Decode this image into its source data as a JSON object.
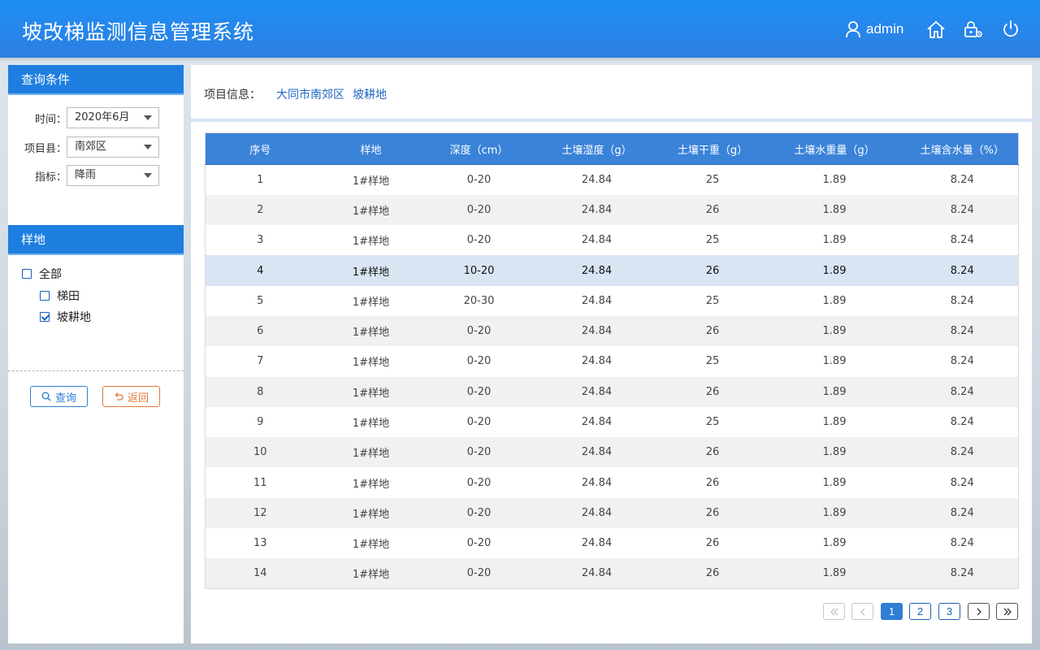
{
  "header": {
    "app_title": "坡改梯监测信息管理系统",
    "user": "admin",
    "icons": [
      "user-icon",
      "home-icon",
      "lock-settings-icon",
      "power-icon"
    ]
  },
  "query": {
    "title": "查询条件",
    "time_label": "时间：",
    "time_value": "2020年6月",
    "county_label": "项目县：",
    "county_value": "南郊区",
    "index_label": "指标：",
    "index_value": "降雨"
  },
  "plots": {
    "title": "样地",
    "all_label": "全部",
    "all_checked": false,
    "terrace_label": "梯田",
    "terrace_checked": false,
    "slope_label": "坡耕地",
    "slope_checked": true
  },
  "buttons": {
    "query_label": "查询",
    "back_label": "返回"
  },
  "project_info": {
    "label": "项目信息：",
    "location": "大同市南郊区",
    "type": "坡耕地"
  },
  "table": {
    "columns": [
      "序号",
      "样地",
      "深度（cm）",
      "土壤湿度（g）",
      "土壤干重（g）",
      "土壤水重量（g）",
      "土壤含水量（%）"
    ],
    "rows": [
      [
        "1",
        "1#样地",
        "0-20",
        "24.84",
        "25",
        "1.89",
        "8.24"
      ],
      [
        "2",
        "1#样地",
        "0-20",
        "24.84",
        "26",
        "1.89",
        "8.24"
      ],
      [
        "3",
        "1#样地",
        "0-20",
        "24.84",
        "25",
        "1.89",
        "8.24"
      ],
      [
        "4",
        "1#样地",
        "10-20",
        "24.84",
        "26",
        "1.89",
        "8.24"
      ],
      [
        "5",
        "1#样地",
        "20-30",
        "24.84",
        "25",
        "1.89",
        "8.24"
      ],
      [
        "6",
        "1#样地",
        "0-20",
        "24.84",
        "26",
        "1.89",
        "8.24"
      ],
      [
        "7",
        "1#样地",
        "0-20",
        "24.84",
        "25",
        "1.89",
        "8.24"
      ],
      [
        "8",
        "1#样地",
        "0-20",
        "24.84",
        "26",
        "1.89",
        "8.24"
      ],
      [
        "9",
        "1#样地",
        "0-20",
        "24.84",
        "25",
        "1.89",
        "8.24"
      ],
      [
        "10",
        "1#样地",
        "0-20",
        "24.84",
        "26",
        "1.89",
        "8.24"
      ],
      [
        "11",
        "1#样地",
        "0-20",
        "24.84",
        "26",
        "1.89",
        "8.24"
      ],
      [
        "12",
        "1#样地",
        "0-20",
        "24.84",
        "26",
        "1.89",
        "8.24"
      ],
      [
        "13",
        "1#样地",
        "0-20",
        "24.84",
        "26",
        "1.89",
        "8.24"
      ],
      [
        "14",
        "1#样地",
        "0-20",
        "24.84",
        "26",
        "1.89",
        "8.24"
      ]
    ],
    "selected_row": 3
  },
  "pagination": {
    "pages": [
      "1",
      "2",
      "3"
    ],
    "current": "1",
    "first": "«",
    "prev": "‹",
    "next": "›",
    "last": "»"
  },
  "colors": {
    "header_blue": "#1f8ef5",
    "panel_head_blue": "#1d7ee0",
    "table_head_blue": "#3a83d9",
    "link_blue": "#1f66c1",
    "back_orange": "#e07a3c",
    "selected_row": "#d9e5f3"
  }
}
